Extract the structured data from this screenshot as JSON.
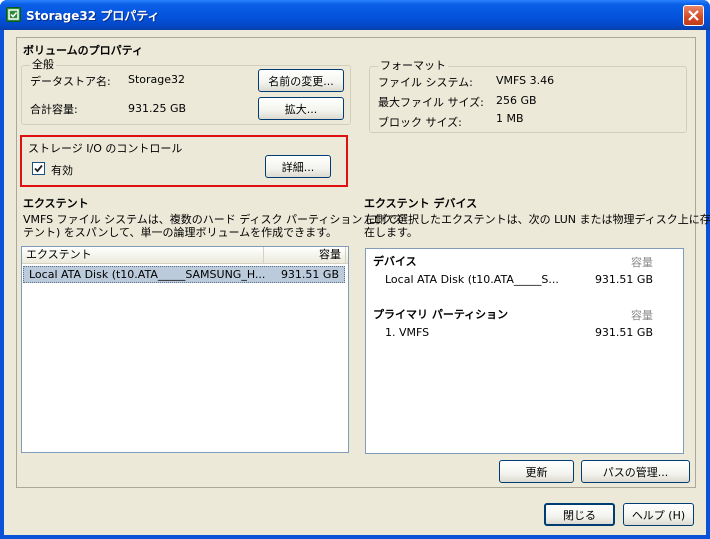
{
  "window": {
    "title": "Storage32 プロパティ"
  },
  "volume": {
    "heading": "ボリュームのプロパティ",
    "general": {
      "legend": "全般",
      "datastore_label": "データストア名:",
      "datastore_value": "Storage32",
      "capacity_label": "合計容量:",
      "capacity_value": "931.25 GB",
      "rename_button": "名前の変更...",
      "expand_button": "拡大..."
    },
    "format": {
      "legend": "フォーマット",
      "filesystem_label": "ファイル システム:",
      "filesystem_value": "VMFS 3.46",
      "max_file_label": "最大ファイル サイズ:",
      "max_file_value": "256 GB",
      "block_label": "ブロック サイズ:",
      "block_value": "1 MB"
    },
    "sioc": {
      "legend": "ストレージ I/O のコントロール",
      "checkbox_label": "有効",
      "checked": true,
      "details_button": "詳細..."
    }
  },
  "extents": {
    "heading": "エクステント",
    "description_line1": "VMFS ファイル システムは、複数のハード ディスク パーティション (エクス",
    "description_line2": "テント) をスパンして、単一の論理ボリュームを作成できます。",
    "columns": [
      "エクステント",
      "容量"
    ],
    "rows": [
      {
        "name": "Local ATA Disk (t10.ATA_____SAMSUNG_H...",
        "capacity": "931.51 GB"
      }
    ]
  },
  "extent_device": {
    "heading": "エクステント デバイス",
    "description_line1": "左側で選択したエクステントは、次の LUN または物理ディスク上に存",
    "description_line2": "在します。",
    "device_heading": "デバイス",
    "capacity_heading": "容量",
    "device_name": "Local ATA Disk (t10.ATA_____S...",
    "device_capacity": "931.51 GB",
    "partition_heading": "プライマリ パーティション",
    "partition_capacity_heading": "容量",
    "partition_name": "1. VMFS",
    "partition_capacity": "931.51 GB"
  },
  "buttons": {
    "refresh": "更新",
    "manage_paths": "パスの管理...",
    "close": "閉じる",
    "help": "ヘルプ (H)"
  },
  "colors": {
    "titlebar": "#0453dc",
    "highlight_box": "#e01010",
    "selection": "#bbcbdc"
  }
}
